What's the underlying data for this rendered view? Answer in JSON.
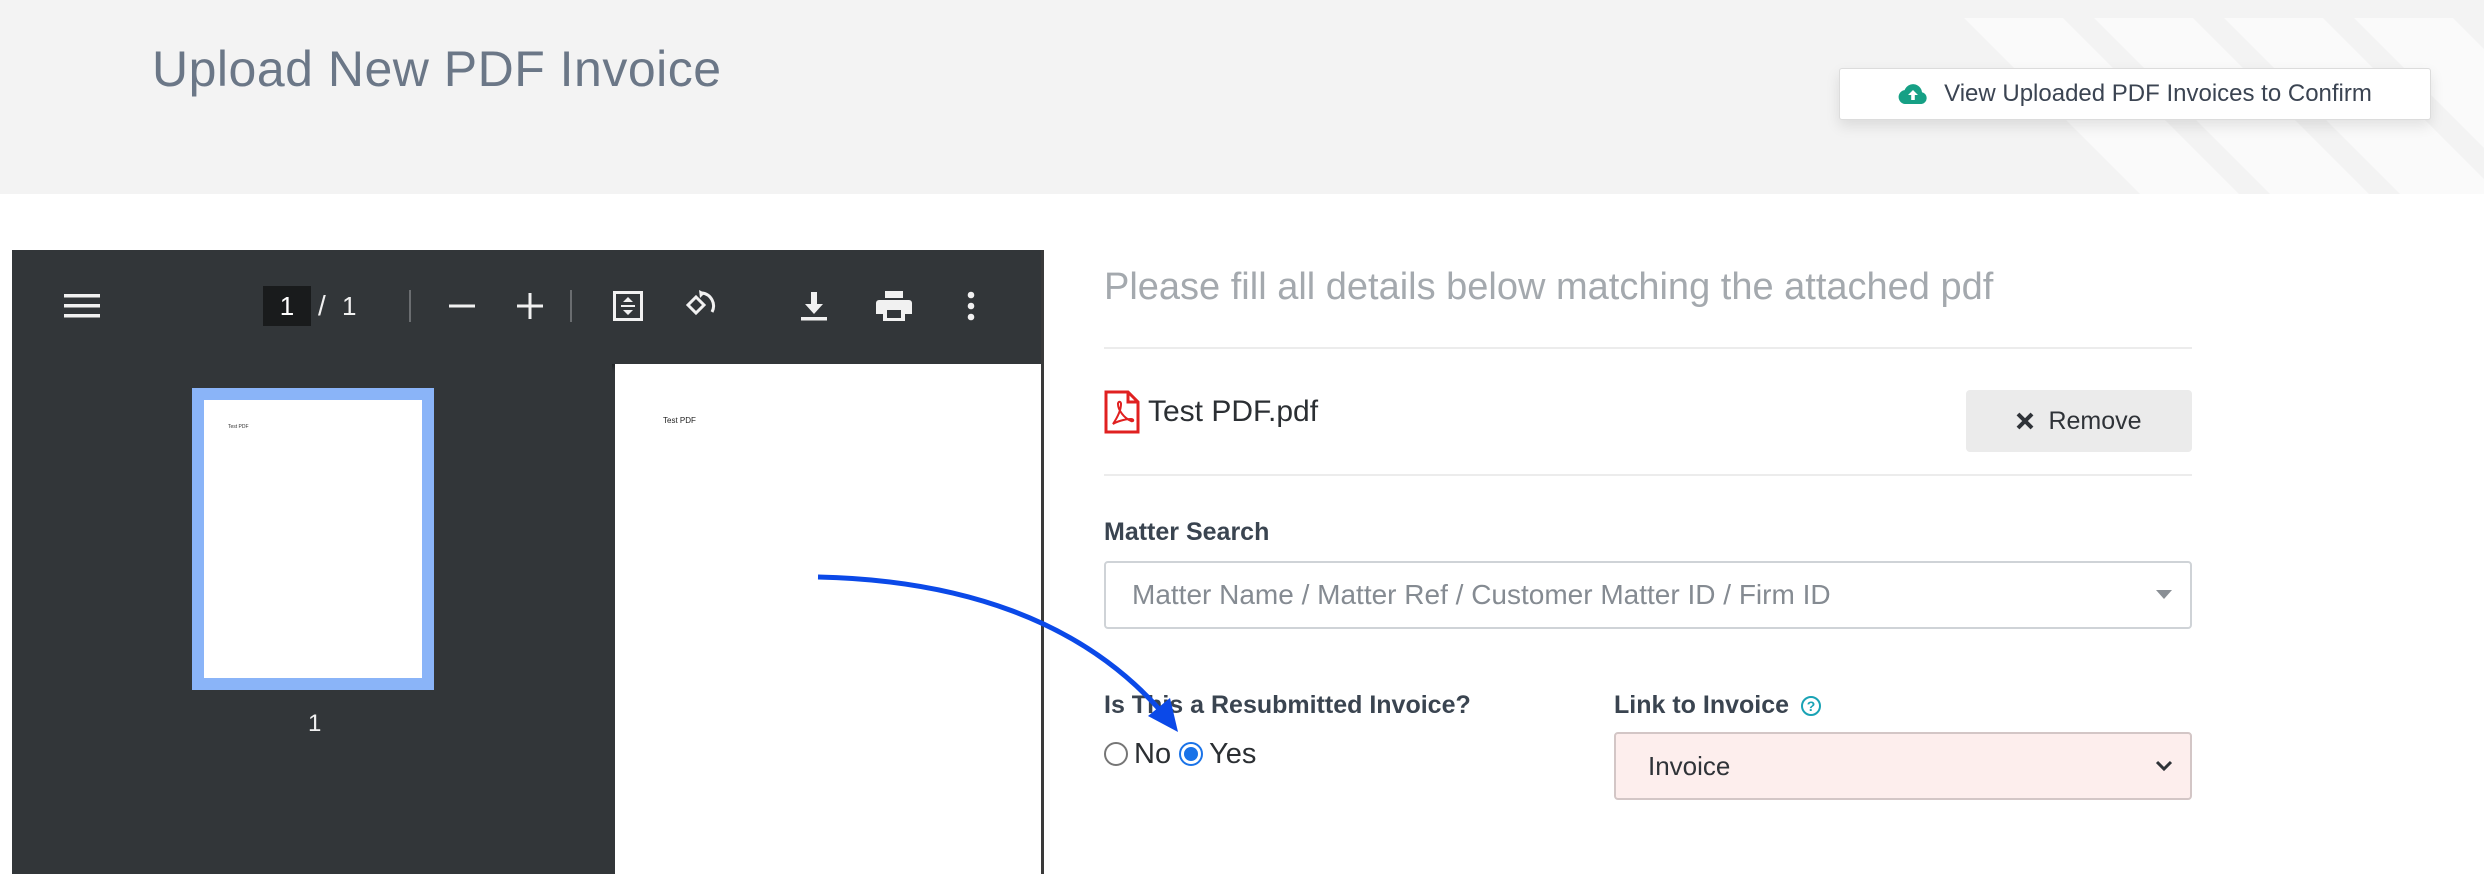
{
  "header": {
    "title": "Upload New PDF Invoice",
    "view_button_label": "View Uploaded PDF Invoices to Confirm",
    "view_button_icon": "cloud-upload-icon",
    "accent_color": "#16a085"
  },
  "pdf_viewer": {
    "current_page": "1",
    "page_separator": "/",
    "total_pages": "1",
    "thumbnail_label": "1",
    "page_text": "Test PDF",
    "thumbnail_text": "Test PDF",
    "thumbnail_highlight_color": "#8ab4f8",
    "icons": [
      "menu-icon",
      "zoom-out-icon",
      "zoom-in-icon",
      "fit-page-icon",
      "rotate-icon",
      "download-icon",
      "print-icon",
      "more-options-icon"
    ]
  },
  "form": {
    "instruction": "Please fill all details below matching the attached pdf",
    "file_name": "Test PDF.pdf",
    "file_icon": "pdf-file-icon",
    "remove_label": "Remove",
    "matter_search": {
      "label": "Matter Search",
      "placeholder": "Matter Name / Matter Ref / Customer Matter ID / Firm ID"
    },
    "resubmitted": {
      "label": "Is This a Resubmitted Invoice?",
      "options": [
        "No",
        "Yes"
      ],
      "selected": "Yes"
    },
    "link_to_invoice": {
      "label": "Link to Invoice",
      "help_glyph": "?",
      "selected_value": "Invoice"
    }
  },
  "annotation": {
    "color": "#0b49e8"
  }
}
